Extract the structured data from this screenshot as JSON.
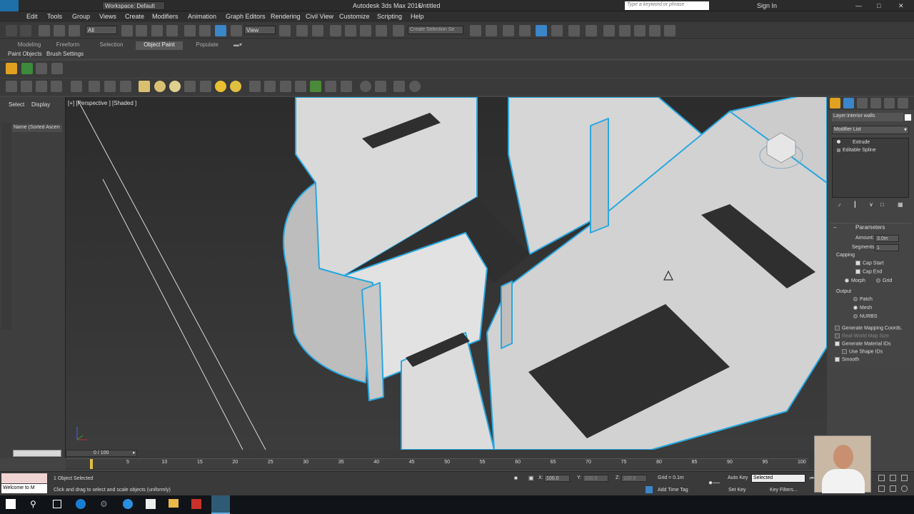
{
  "title_bar": {
    "workspace": "Workspace: Default",
    "app_title": "Autodesk 3ds Max 2016",
    "doc_title": "Untitled",
    "search_placeholder": "Type a keyword or phrase",
    "sign_in": "Sign In"
  },
  "menu": [
    "Edit",
    "Tools",
    "Group",
    "Views",
    "Create",
    "Modifiers",
    "Animation",
    "Graph Editors",
    "Rendering",
    "Civil View",
    "Customize",
    "Scripting",
    "Help"
  ],
  "toolbar": {
    "selection_filter": "All",
    "ref_coord": "View",
    "named_selection": "Create Selection Se"
  },
  "ribbon": {
    "tabs": [
      "Modeling",
      "Freeform",
      "Selection",
      "Object Paint",
      "Populate"
    ],
    "active_tab": "Object Paint",
    "subtabs": [
      "Paint Objects",
      "Brush Settings"
    ]
  },
  "scene_explorer": {
    "tabs": [
      "Select",
      "Display"
    ],
    "column": "Name (Sorted Ascen"
  },
  "viewport": {
    "label": "[+] [Perspective ] [Shaded ]"
  },
  "command_panel": {
    "layer": "Layer:interior walls",
    "modifier_list": "Modifier List",
    "stack": [
      "Extrude",
      "Editable Spline"
    ],
    "parameters_title": "Parameters",
    "amount_label": "Amount:",
    "amount_value": "3.0m",
    "segments_label": "Segments:",
    "segments_value": "1",
    "capping_label": "Capping",
    "cap_start": "Cap Start",
    "cap_end": "Cap End",
    "morph": "Morph",
    "grid": "Grid",
    "output_label": "Output",
    "patch": "Patch",
    "mesh": "Mesh",
    "nurbs": "NURBS",
    "gen_mapping": "Generate Mapping Coords.",
    "real_world": "Real-World Map Size",
    "gen_material": "Generate Material IDs",
    "use_shape": "Use Shape IDs",
    "smooth": "Smooth"
  },
  "timeline": {
    "frame": "0 / 100",
    "ticks": [
      "5",
      "10",
      "15",
      "20",
      "25",
      "30",
      "35",
      "40",
      "45",
      "50",
      "55",
      "60",
      "65",
      "70",
      "75",
      "80",
      "85",
      "90",
      "95",
      "100"
    ]
  },
  "status": {
    "maxscript": "Welcome to M",
    "selected": "1 Object Selected",
    "prompt": "Click and drag to select and scale objects (uniformly)",
    "x_label": "X:",
    "x_value": "100.0",
    "y_label": "Y:",
    "y_value": "100.0",
    "z_label": "Z:",
    "z_value": "100.0",
    "grid": "Grid = 0.1m",
    "add_time_tag": "Add Time Tag",
    "auto_key": "Auto Key",
    "set_key": "Set Key",
    "selected_dropdown": "Selected",
    "key_filters": "Key Filters..."
  },
  "colors": {
    "viewport_bg": "#2f2f2f",
    "wall": "#d9d9d9",
    "selection_outline": "#29a8e0",
    "panel": "#444444"
  }
}
